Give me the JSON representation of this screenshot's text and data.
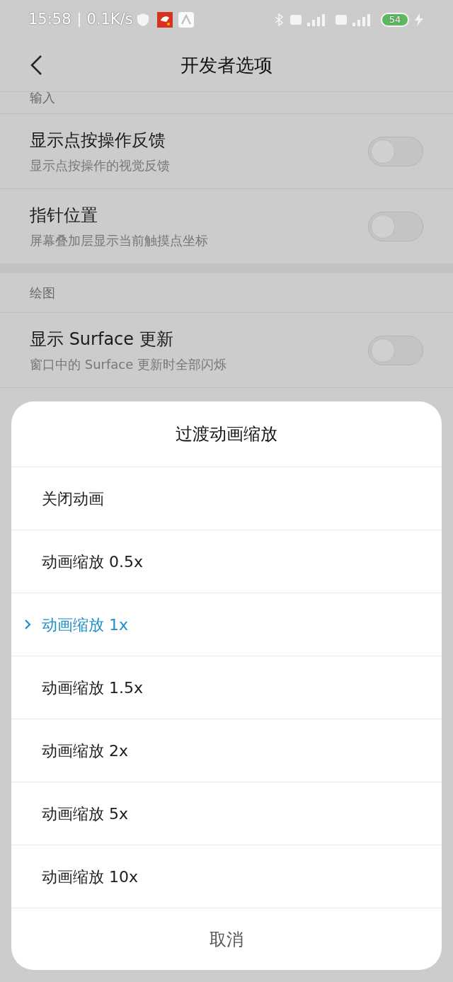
{
  "status_bar": {
    "time": "15:58",
    "net_speed": "0.1K/s",
    "battery": "54"
  },
  "header": {
    "title": "开发者选项"
  },
  "sections": [
    {
      "title": "输入",
      "items": [
        {
          "title": "显示点按操作反馈",
          "subtitle": "显示点按操作的视觉反馈",
          "on": false
        },
        {
          "title": "指针位置",
          "subtitle": "屏幕叠加层显示当前触摸点坐标",
          "on": false
        }
      ]
    },
    {
      "title": "绘图",
      "items": [
        {
          "title": "显示 Surface 更新",
          "subtitle": "窗口中的 Surface 更新时全部闪烁",
          "on": false
        }
      ]
    }
  ],
  "dialog": {
    "title": "过渡动画缩放",
    "options": [
      {
        "label": "关闭动画",
        "selected": false
      },
      {
        "label": "动画缩放 0.5x",
        "selected": false
      },
      {
        "label": "动画缩放 1x",
        "selected": true
      },
      {
        "label": "动画缩放 1.5x",
        "selected": false
      },
      {
        "label": "动画缩放 2x",
        "selected": false
      },
      {
        "label": "动画缩放 5x",
        "selected": false
      },
      {
        "label": "动画缩放 10x",
        "selected": false
      }
    ],
    "cancel": "取消"
  }
}
